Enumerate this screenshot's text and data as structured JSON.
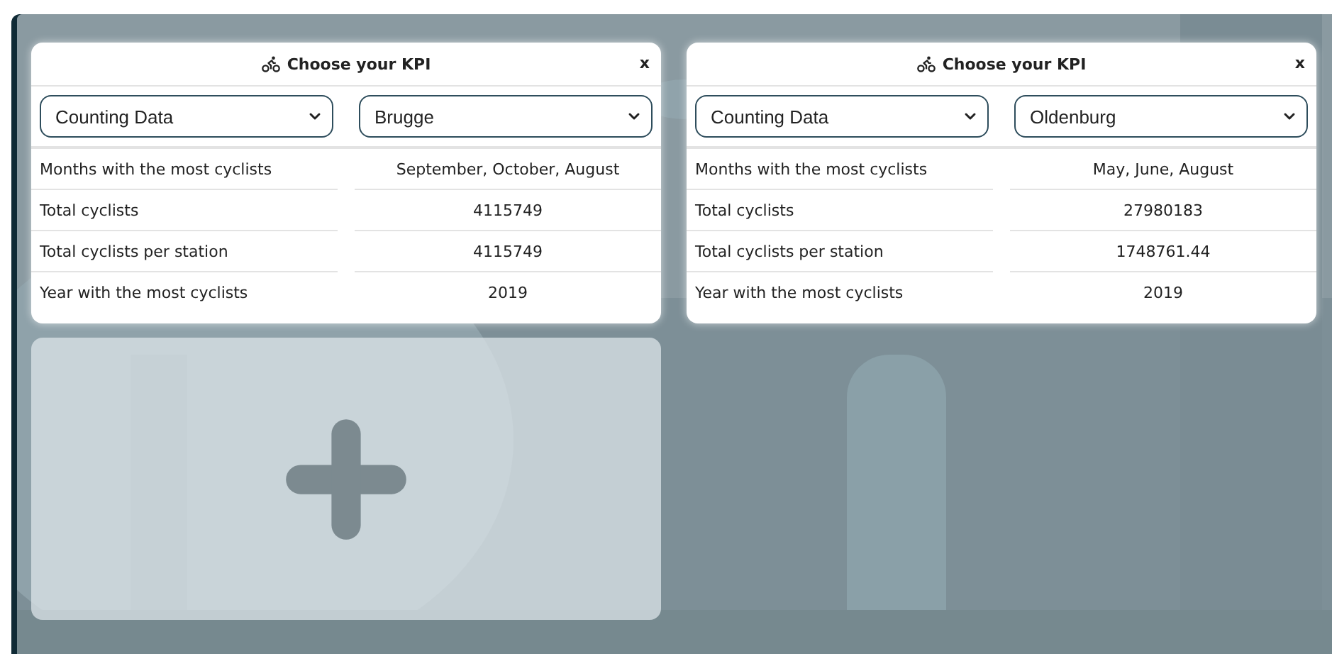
{
  "cards": [
    {
      "title": "Choose your KPI",
      "close": "x",
      "dataset": "Counting Data",
      "location": "Brugge",
      "rows": [
        {
          "label": "Months with the most cyclists",
          "value": "September, October, August"
        },
        {
          "label": "Total cyclists",
          "value": "4115749"
        },
        {
          "label": "Total cyclists per station",
          "value": "4115749"
        },
        {
          "label": "Year with the most cyclists",
          "value": "2019"
        }
      ]
    },
    {
      "title": "Choose your KPI",
      "close": "x",
      "dataset": "Counting Data",
      "location": "Oldenburg",
      "rows": [
        {
          "label": "Months with the most cyclists",
          "value": "May, June, August"
        },
        {
          "label": "Total cyclists",
          "value": "27980183"
        },
        {
          "label": "Total cyclists per station",
          "value": "1748761.44"
        },
        {
          "label": "Year with the most cyclists",
          "value": "2019"
        }
      ]
    }
  ],
  "add_card": {
    "kind": "add"
  }
}
